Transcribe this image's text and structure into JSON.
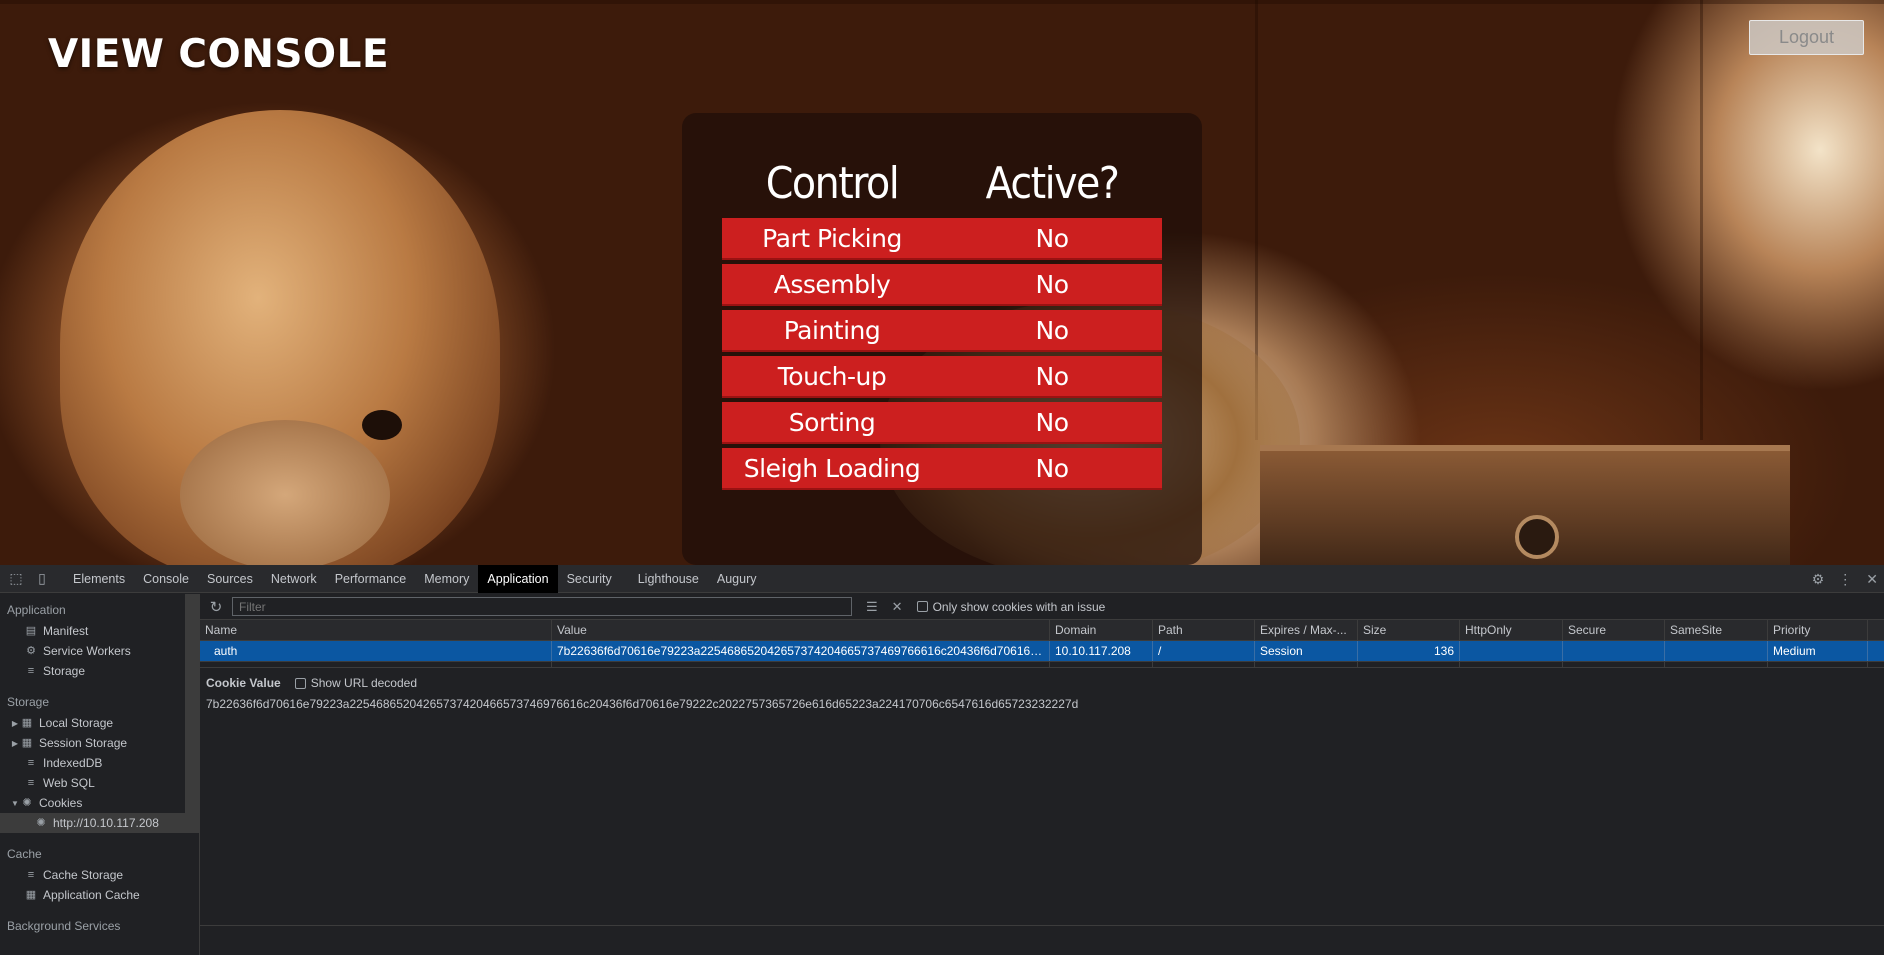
{
  "page": {
    "brand": "VIEW CONSOLE",
    "logout_label": "Logout",
    "table": {
      "headers": [
        "Control",
        "Active?"
      ],
      "rows": [
        {
          "control": "Part Picking",
          "active": "No"
        },
        {
          "control": "Assembly",
          "active": "No"
        },
        {
          "control": "Painting",
          "active": "No"
        },
        {
          "control": "Touch-up",
          "active": "No"
        },
        {
          "control": "Sorting",
          "active": "No"
        },
        {
          "control": "Sleigh Loading",
          "active": "No"
        }
      ]
    },
    "colors": {
      "row_red": "#cc1f1f",
      "panel": "#1e0e08"
    }
  },
  "devtools": {
    "tabs": [
      "Elements",
      "Console",
      "Sources",
      "Network",
      "Performance",
      "Memory",
      "Application",
      "Security",
      "Lighthouse",
      "Augury"
    ],
    "active_tab": "Application",
    "right_icons": [
      "gear-icon",
      "kebab-menu-icon",
      "close-icon"
    ],
    "sidebar": {
      "application": {
        "title": "Application",
        "items": [
          "Manifest",
          "Service Workers",
          "Storage"
        ]
      },
      "storage": {
        "title": "Storage",
        "items": [
          "Local Storage",
          "Session Storage",
          "IndexedDB",
          "Web SQL",
          "Cookies"
        ],
        "cookie_origin": "http://10.10.117.208"
      },
      "cache": {
        "title": "Cache",
        "items": [
          "Cache Storage",
          "Application Cache"
        ]
      },
      "background": {
        "title": "Background Services"
      }
    },
    "toolbar": {
      "filter_placeholder": "Filter",
      "only_issue_label": "Only show cookies with an issue"
    },
    "cookies_table": {
      "columns": [
        "Name",
        "Value",
        "Domain",
        "Path",
        "Expires / Max-...",
        "Size",
        "HttpOnly",
        "Secure",
        "SameSite",
        "Priority"
      ],
      "rows": [
        {
          "name": "auth",
          "value": "7b22636f6d70616e79223a225468652042657374204665737469766616c20436f6d70616e...",
          "domain": "10.10.117.208",
          "path": "/",
          "expires": "Session",
          "size": "136",
          "httponly": "",
          "secure": "",
          "samesite": "",
          "priority": "Medium"
        }
      ]
    },
    "cookie_value": {
      "title": "Cookie Value",
      "show_decoded_label": "Show URL decoded",
      "value": "7b22636f6d70616e79223a22546865204265737420466573746976616c20436f6d70616e79222c2022757365726e616d65223a224170706c6547616d65723232227d"
    }
  }
}
